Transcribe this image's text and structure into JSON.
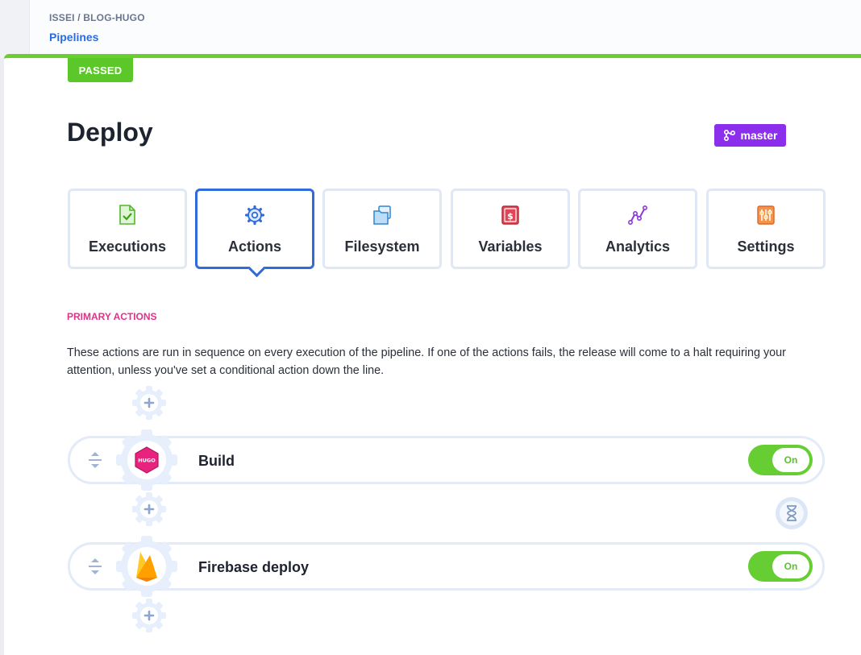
{
  "breadcrumb": {
    "repo": "ISSEI / BLOG-HUGO",
    "section": "Pipelines"
  },
  "status": {
    "label": "PASSED",
    "color": "#5cc728"
  },
  "pipeline": {
    "title": "Deploy",
    "branch": "master",
    "branch_icon": "branch-icon"
  },
  "tabs": [
    {
      "label": "Executions",
      "icon": "document-check-icon"
    },
    {
      "label": "Actions",
      "icon": "gear-icon",
      "active": true
    },
    {
      "label": "Filesystem",
      "icon": "folder-icon"
    },
    {
      "label": "Variables",
      "icon": "dollar-icon"
    },
    {
      "label": "Analytics",
      "icon": "chart-line-icon"
    },
    {
      "label": "Settings",
      "icon": "sliders-icon"
    }
  ],
  "primary_actions": {
    "heading": "PRIMARY ACTIONS",
    "description": "These actions are run in sequence on every execution of the pipeline. If one of the actions fails, the release will come to a halt requiring your attention, unless you've set a conditional action down the line.",
    "actions": [
      {
        "name": "Build",
        "logo": "hugo-logo",
        "logo_text": "HUGO",
        "toggle": "On"
      },
      {
        "name": "Firebase deploy",
        "logo": "firebase-logo",
        "toggle": "On"
      }
    ]
  },
  "colors": {
    "accent": "#2f6bd9",
    "section": "#e0318a",
    "toggle_on": "#66cd33",
    "branch": "#8c2fec"
  }
}
